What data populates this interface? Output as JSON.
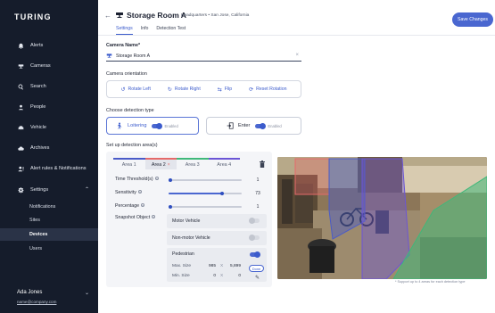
{
  "app": {
    "logo": "TURING"
  },
  "sidebar": {
    "items": [
      {
        "label": "Alerts",
        "icon": "bell-icon"
      },
      {
        "label": "Cameras",
        "icon": "camera-icon"
      },
      {
        "label": "Search",
        "icon": "search-icon"
      },
      {
        "label": "People",
        "icon": "person-icon"
      },
      {
        "label": "Vehicle",
        "icon": "car-icon"
      },
      {
        "label": "Archives",
        "icon": "cloud-icon"
      },
      {
        "label": "Alert rules & Notifications",
        "icon": "alert-rules-icon"
      },
      {
        "label": "Settings",
        "icon": "gear-icon"
      }
    ],
    "settings_sub": [
      {
        "label": "Notifications"
      },
      {
        "label": "Sites"
      },
      {
        "label": "Devices"
      },
      {
        "label": "Users"
      }
    ],
    "active_sub": "Devices",
    "user": {
      "name": "Ada Jones",
      "email": "name@company.com"
    }
  },
  "header": {
    "title": "Storage Room A",
    "breadcrumb": "Headquarters • San Jose, California",
    "tabs": [
      "Settings",
      "Info",
      "Detection Test"
    ],
    "active_tab": "Settings",
    "save_label": "Save Changes"
  },
  "form": {
    "camera_name_label": "Camera Name*",
    "camera_name_value": "Storage Room A",
    "orientation_label": "Camera orientation",
    "orientation_buttons": [
      "Rotate Left",
      "Rotate Right",
      "Flip",
      "Reset Rotation"
    ],
    "detection_label": "Choose detection type",
    "detection_types": [
      {
        "label": "Loitering",
        "status": "Enabled",
        "selected": true
      },
      {
        "label": "Enter",
        "status": "Enabled",
        "selected": false
      }
    ],
    "area_label": "Set up detection area(s)"
  },
  "areas": {
    "tabs": [
      "Area 1",
      "Area 2",
      "Area 3",
      "Area 4"
    ],
    "active": "Area 2",
    "colors": [
      "#4a5bc8",
      "#e56a6a",
      "#3fb87a",
      "#6b55d6"
    ],
    "time_threshold": {
      "label": "Time Threshold(s)",
      "value": "1",
      "fraction": 0.02
    },
    "sensitivity": {
      "label": "Sensitivity",
      "value": "73",
      "fraction": 0.73
    },
    "percentage": {
      "label": "Percentage",
      "value": "1",
      "fraction": 0.02
    },
    "snapshot_label": "Snapshot Object",
    "objects": [
      {
        "label": "Motor Vehicle",
        "enabled": false
      },
      {
        "label": "Non-motor Vehicle",
        "enabled": false
      },
      {
        "label": "Pedestrian",
        "enabled": true
      }
    ],
    "max_size": {
      "label": "Max. Size",
      "w": "985",
      "h": "5,899",
      "button": "Done"
    },
    "min_size": {
      "label": "Min. Size",
      "w": "0",
      "h": "0"
    },
    "x_sep": "X"
  },
  "preview": {
    "note": "* Support up to 4 areas for each detection type"
  }
}
